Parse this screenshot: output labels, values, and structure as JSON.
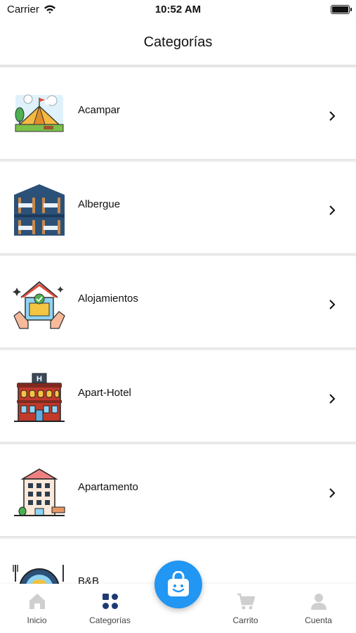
{
  "status_bar": {
    "carrier": "Carrier",
    "time": "10:52 AM"
  },
  "header": {
    "title": "Categorías"
  },
  "categories": [
    {
      "label": "Acampar",
      "icon": "tent-icon"
    },
    {
      "label": "Albergue",
      "icon": "bunk-bed-icon"
    },
    {
      "label": "Alojamientos",
      "icon": "house-hands-icon"
    },
    {
      "label": "Apart-Hotel",
      "icon": "hotel-building-icon"
    },
    {
      "label": "Apartamento",
      "icon": "apartment-building-icon"
    },
    {
      "label": "B&B",
      "icon": "bed-breakfast-icon"
    }
  ],
  "tab_bar": {
    "tabs": [
      {
        "label": "Inicio",
        "icon": "home-icon",
        "active": false
      },
      {
        "label": "Categorías",
        "icon": "categories-icon",
        "active": true
      },
      {
        "label": "Carrito",
        "icon": "cart-icon",
        "active": false
      },
      {
        "label": "Cuenta",
        "icon": "user-icon",
        "active": false
      }
    ],
    "center_button_icon": "shopping-bag-icon"
  },
  "colors": {
    "accent": "#2196f3",
    "active_tab": "#1e3a73",
    "inactive_tab": "#cfcfcf"
  }
}
